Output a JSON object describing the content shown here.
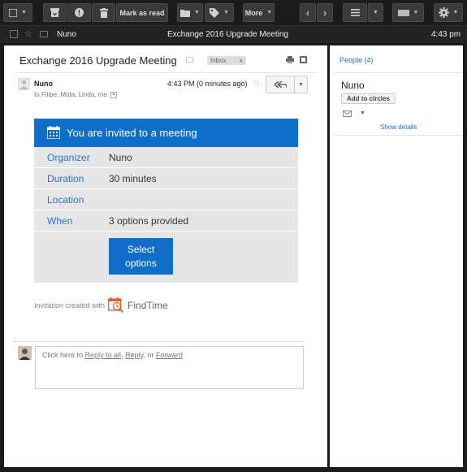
{
  "toolbar": {
    "mark_as_read": "Mark as read",
    "more": "More"
  },
  "message_row": {
    "sender": "Nuno",
    "subject": "Exchange 2016 Upgrade Meeting",
    "time": "4:43 pm"
  },
  "email": {
    "subject": "Exchange 2016 Upgrade Meeting",
    "label": "Inbox",
    "label_remove": "x",
    "sender": "Nuno",
    "recipients": "to Filipe, Mota, Linda, me",
    "time": "4:43 PM (0 minutes ago)"
  },
  "invite": {
    "title": "You are invited to a meeting",
    "rows": [
      {
        "key": "Organizer",
        "value": "Nuno"
      },
      {
        "key": "Duration",
        "value": "30 minutes"
      },
      {
        "key": "Location",
        "value": ""
      },
      {
        "key": "When",
        "value": "3 options provided"
      }
    ],
    "button_line1": "Select",
    "button_line2": "options",
    "accent": "#0f6ec9"
  },
  "findtime": {
    "prefix": "Invitation created with",
    "name": "FindTime"
  },
  "reply": {
    "prefix": "Click here to ",
    "reply_all": "Reply to all",
    "sep1": ", ",
    "reply": "Reply",
    "sep2": ", or ",
    "forward": "Forward"
  },
  "sidebar": {
    "people": "People (4)",
    "name": "Nuno",
    "add_circles": "Add to circles",
    "show_details": "Show details"
  }
}
